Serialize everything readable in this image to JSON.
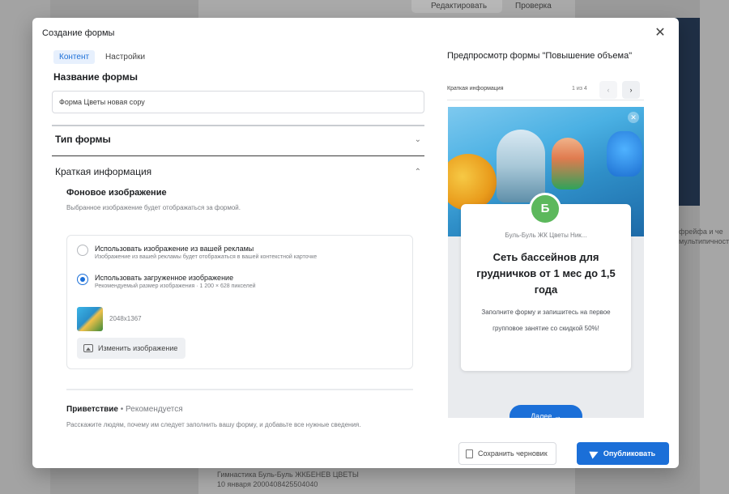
{
  "background": {
    "top_button": "Редактировать",
    "top_button2": "Проверка",
    "right_text": "фрейфа и че\nмультипичность",
    "footer_text": "Гимнастика Буль-Буль ЖКБЕНЕВ ЦВЕТЫ\n10 января  2000408425504040"
  },
  "modal": {
    "title": "Создание формы",
    "close_glyph": "✕",
    "tabs": [
      {
        "label": "Контент"
      },
      {
        "label": "Настройки"
      }
    ],
    "form_name": {
      "label": "Название формы",
      "value": "Форма Цветы новая сору"
    },
    "form_type": {
      "label": "Тип формы"
    },
    "brief_info": {
      "label": "Краткая информация",
      "bg_image": {
        "label": "Фоновое изображение",
        "desc": "Выбранное изображение будет отображаться за формой.",
        "options": [
          {
            "title": "Использовать изображение из вашей рекламы",
            "hint": "Изображение из вашей рекламы будет отображаться в вашей контекстной карточке",
            "checked": false
          },
          {
            "title": "Использовать загруженное изображение",
            "hint": "Рекомендуемый размер изображения · 1 200 × 628 пикселей",
            "checked": true
          }
        ],
        "dimensions": "2048x1367",
        "change_button": "Изменить изображение"
      },
      "greeting": {
        "label": "Приветствие",
        "recommended": " • Рекомендуется",
        "desc": "Расскажите людям, почему им следует заполнить вашу форму, и добавьте все нужные сведения."
      }
    },
    "preview": {
      "title": "Предпросмотр формы \"Повышение объема\"",
      "section": "Краткая информация",
      "count": "1 из 4",
      "prev_glyph": "‹",
      "next_glyph": "›",
      "close_glyph": "✕",
      "avatar_letter": "Б",
      "page_name": "Буль-Буль ЖК Цветы Ник...",
      "headline": "Сеть бассейнов для грудничков от 1 мес до 1,5 года",
      "body": "Заполните форму и запишитесь на первое групповое занятие со скидкой 50%!",
      "cta": "Далее →"
    },
    "footer": {
      "draft_button": "Сохранить черновик",
      "publish_button": "Опубликовать"
    }
  }
}
